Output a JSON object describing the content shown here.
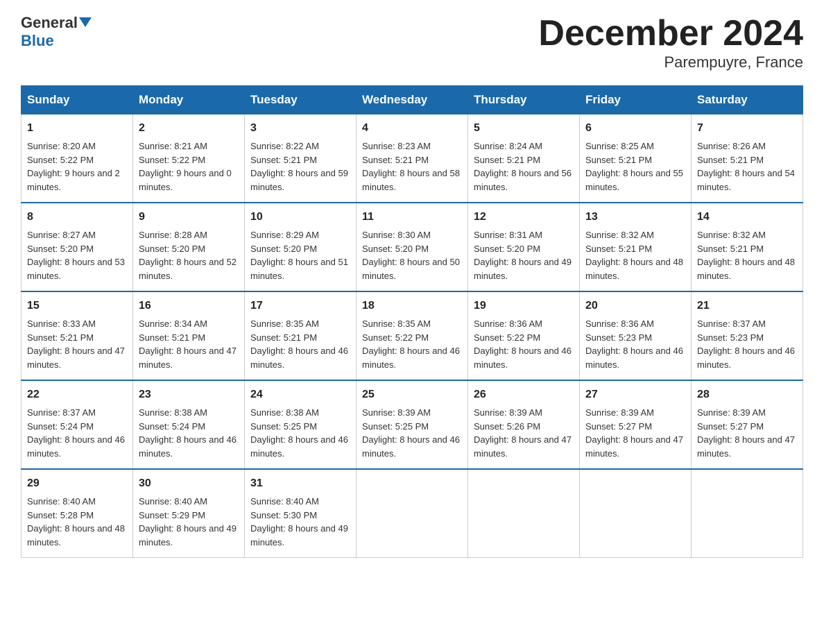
{
  "logo": {
    "line1": "General",
    "arrow": "▼",
    "line2": "Blue"
  },
  "title": "December 2024",
  "subtitle": "Parempuyre, France",
  "days_of_week": [
    "Sunday",
    "Monday",
    "Tuesday",
    "Wednesday",
    "Thursday",
    "Friday",
    "Saturday"
  ],
  "weeks": [
    [
      {
        "day": "1",
        "sunrise": "8:20 AM",
        "sunset": "5:22 PM",
        "daylight": "9 hours and 2 minutes."
      },
      {
        "day": "2",
        "sunrise": "8:21 AM",
        "sunset": "5:22 PM",
        "daylight": "9 hours and 0 minutes."
      },
      {
        "day": "3",
        "sunrise": "8:22 AM",
        "sunset": "5:21 PM",
        "daylight": "8 hours and 59 minutes."
      },
      {
        "day": "4",
        "sunrise": "8:23 AM",
        "sunset": "5:21 PM",
        "daylight": "8 hours and 58 minutes."
      },
      {
        "day": "5",
        "sunrise": "8:24 AM",
        "sunset": "5:21 PM",
        "daylight": "8 hours and 56 minutes."
      },
      {
        "day": "6",
        "sunrise": "8:25 AM",
        "sunset": "5:21 PM",
        "daylight": "8 hours and 55 minutes."
      },
      {
        "day": "7",
        "sunrise": "8:26 AM",
        "sunset": "5:21 PM",
        "daylight": "8 hours and 54 minutes."
      }
    ],
    [
      {
        "day": "8",
        "sunrise": "8:27 AM",
        "sunset": "5:20 PM",
        "daylight": "8 hours and 53 minutes."
      },
      {
        "day": "9",
        "sunrise": "8:28 AM",
        "sunset": "5:20 PM",
        "daylight": "8 hours and 52 minutes."
      },
      {
        "day": "10",
        "sunrise": "8:29 AM",
        "sunset": "5:20 PM",
        "daylight": "8 hours and 51 minutes."
      },
      {
        "day": "11",
        "sunrise": "8:30 AM",
        "sunset": "5:20 PM",
        "daylight": "8 hours and 50 minutes."
      },
      {
        "day": "12",
        "sunrise": "8:31 AM",
        "sunset": "5:20 PM",
        "daylight": "8 hours and 49 minutes."
      },
      {
        "day": "13",
        "sunrise": "8:32 AM",
        "sunset": "5:21 PM",
        "daylight": "8 hours and 48 minutes."
      },
      {
        "day": "14",
        "sunrise": "8:32 AM",
        "sunset": "5:21 PM",
        "daylight": "8 hours and 48 minutes."
      }
    ],
    [
      {
        "day": "15",
        "sunrise": "8:33 AM",
        "sunset": "5:21 PM",
        "daylight": "8 hours and 47 minutes."
      },
      {
        "day": "16",
        "sunrise": "8:34 AM",
        "sunset": "5:21 PM",
        "daylight": "8 hours and 47 minutes."
      },
      {
        "day": "17",
        "sunrise": "8:35 AM",
        "sunset": "5:21 PM",
        "daylight": "8 hours and 46 minutes."
      },
      {
        "day": "18",
        "sunrise": "8:35 AM",
        "sunset": "5:22 PM",
        "daylight": "8 hours and 46 minutes."
      },
      {
        "day": "19",
        "sunrise": "8:36 AM",
        "sunset": "5:22 PM",
        "daylight": "8 hours and 46 minutes."
      },
      {
        "day": "20",
        "sunrise": "8:36 AM",
        "sunset": "5:23 PM",
        "daylight": "8 hours and 46 minutes."
      },
      {
        "day": "21",
        "sunrise": "8:37 AM",
        "sunset": "5:23 PM",
        "daylight": "8 hours and 46 minutes."
      }
    ],
    [
      {
        "day": "22",
        "sunrise": "8:37 AM",
        "sunset": "5:24 PM",
        "daylight": "8 hours and 46 minutes."
      },
      {
        "day": "23",
        "sunrise": "8:38 AM",
        "sunset": "5:24 PM",
        "daylight": "8 hours and 46 minutes."
      },
      {
        "day": "24",
        "sunrise": "8:38 AM",
        "sunset": "5:25 PM",
        "daylight": "8 hours and 46 minutes."
      },
      {
        "day": "25",
        "sunrise": "8:39 AM",
        "sunset": "5:25 PM",
        "daylight": "8 hours and 46 minutes."
      },
      {
        "day": "26",
        "sunrise": "8:39 AM",
        "sunset": "5:26 PM",
        "daylight": "8 hours and 47 minutes."
      },
      {
        "day": "27",
        "sunrise": "8:39 AM",
        "sunset": "5:27 PM",
        "daylight": "8 hours and 47 minutes."
      },
      {
        "day": "28",
        "sunrise": "8:39 AM",
        "sunset": "5:27 PM",
        "daylight": "8 hours and 47 minutes."
      }
    ],
    [
      {
        "day": "29",
        "sunrise": "8:40 AM",
        "sunset": "5:28 PM",
        "daylight": "8 hours and 48 minutes."
      },
      {
        "day": "30",
        "sunrise": "8:40 AM",
        "sunset": "5:29 PM",
        "daylight": "8 hours and 49 minutes."
      },
      {
        "day": "31",
        "sunrise": "8:40 AM",
        "sunset": "5:30 PM",
        "daylight": "8 hours and 49 minutes."
      },
      {
        "day": "",
        "sunrise": "",
        "sunset": "",
        "daylight": ""
      },
      {
        "day": "",
        "sunrise": "",
        "sunset": "",
        "daylight": ""
      },
      {
        "day": "",
        "sunrise": "",
        "sunset": "",
        "daylight": ""
      },
      {
        "day": "",
        "sunrise": "",
        "sunset": "",
        "daylight": ""
      }
    ]
  ]
}
